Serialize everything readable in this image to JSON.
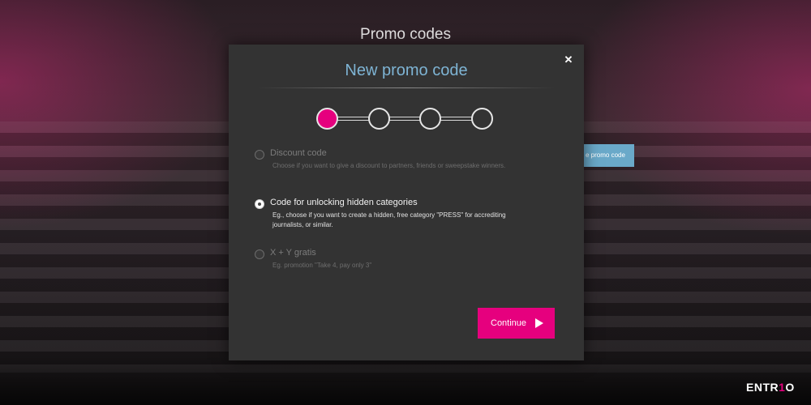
{
  "page": {
    "title": "Promo codes",
    "behind_button_label": "e promo code"
  },
  "modal": {
    "close_icon": "close-icon",
    "close_glyph": "✕",
    "title": "New promo code",
    "stepper": {
      "total_steps": 4,
      "current_step": 1,
      "active_color": "#e6007e"
    },
    "options": [
      {
        "label": "Discount code",
        "description": "Choose if you want to give a discount to partners, friends or sweepstake winners.",
        "selected": false,
        "enabled": false
      },
      {
        "label": "Code for unlocking hidden categories",
        "description": "Eg., choose if you want to create a hidden, free category \"PRESS\" for accrediting journalists, or similar.",
        "selected": true,
        "enabled": true
      },
      {
        "label": "X + Y gratis",
        "description": "Eg. promotion \"Take 4, pay only 3\"",
        "selected": false,
        "enabled": false
      }
    ],
    "continue_label": "Continue",
    "continue_icon": "play-arrow-icon"
  },
  "brand": {
    "logo_prefix": "ENTR",
    "logo_accent": "1",
    "logo_suffix": "O",
    "accent_color": "#e6007e"
  },
  "colors": {
    "title_blue": "#7eb4d4",
    "modal_bg": "#333333",
    "accent": "#e6007e"
  }
}
